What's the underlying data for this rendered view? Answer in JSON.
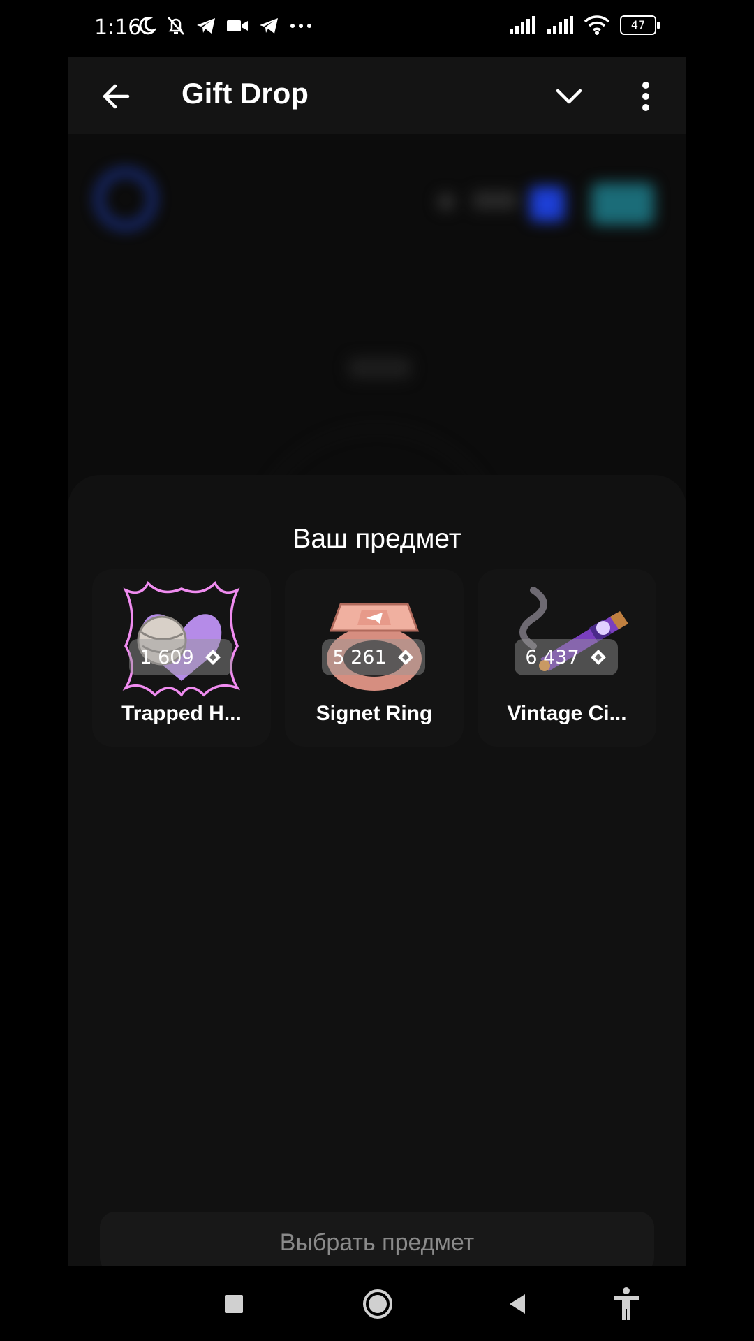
{
  "status_bar": {
    "time": "1:16",
    "left_icons": [
      "moon-icon",
      "bell-off-icon",
      "telegram-icon",
      "video-icon",
      "telegram-icon",
      "more-dots-icon"
    ],
    "right_icons": [
      "signal-icon",
      "signal-icon",
      "wifi-icon"
    ],
    "battery": "47"
  },
  "header": {
    "title": "Gift Drop",
    "back_icon": "arrow-left-icon",
    "dropdown_icon": "chevron-down-icon",
    "menu_icon": "more-vertical-icon"
  },
  "sheet": {
    "title": "Ваш предмет",
    "items": [
      {
        "name": "Trapped H...",
        "price": "1 609",
        "icon": "trapped-heart-icon"
      },
      {
        "name": "Signet Ring",
        "price": "5 261",
        "icon": "signet-ring-icon"
      },
      {
        "name": "Vintage Ci...",
        "price": "6 437",
        "icon": "vintage-cigar-icon"
      }
    ],
    "select_button": "Выбрать предмет"
  },
  "nav_bar": {
    "buttons": [
      "recents-icon",
      "home-icon",
      "back-icon",
      "accessibility-icon"
    ]
  },
  "colors": {
    "background": "#0c0c0c",
    "sheet": "#111111",
    "accent_blue": "#1d3fd6",
    "price_chip": "#8c8c8c"
  }
}
